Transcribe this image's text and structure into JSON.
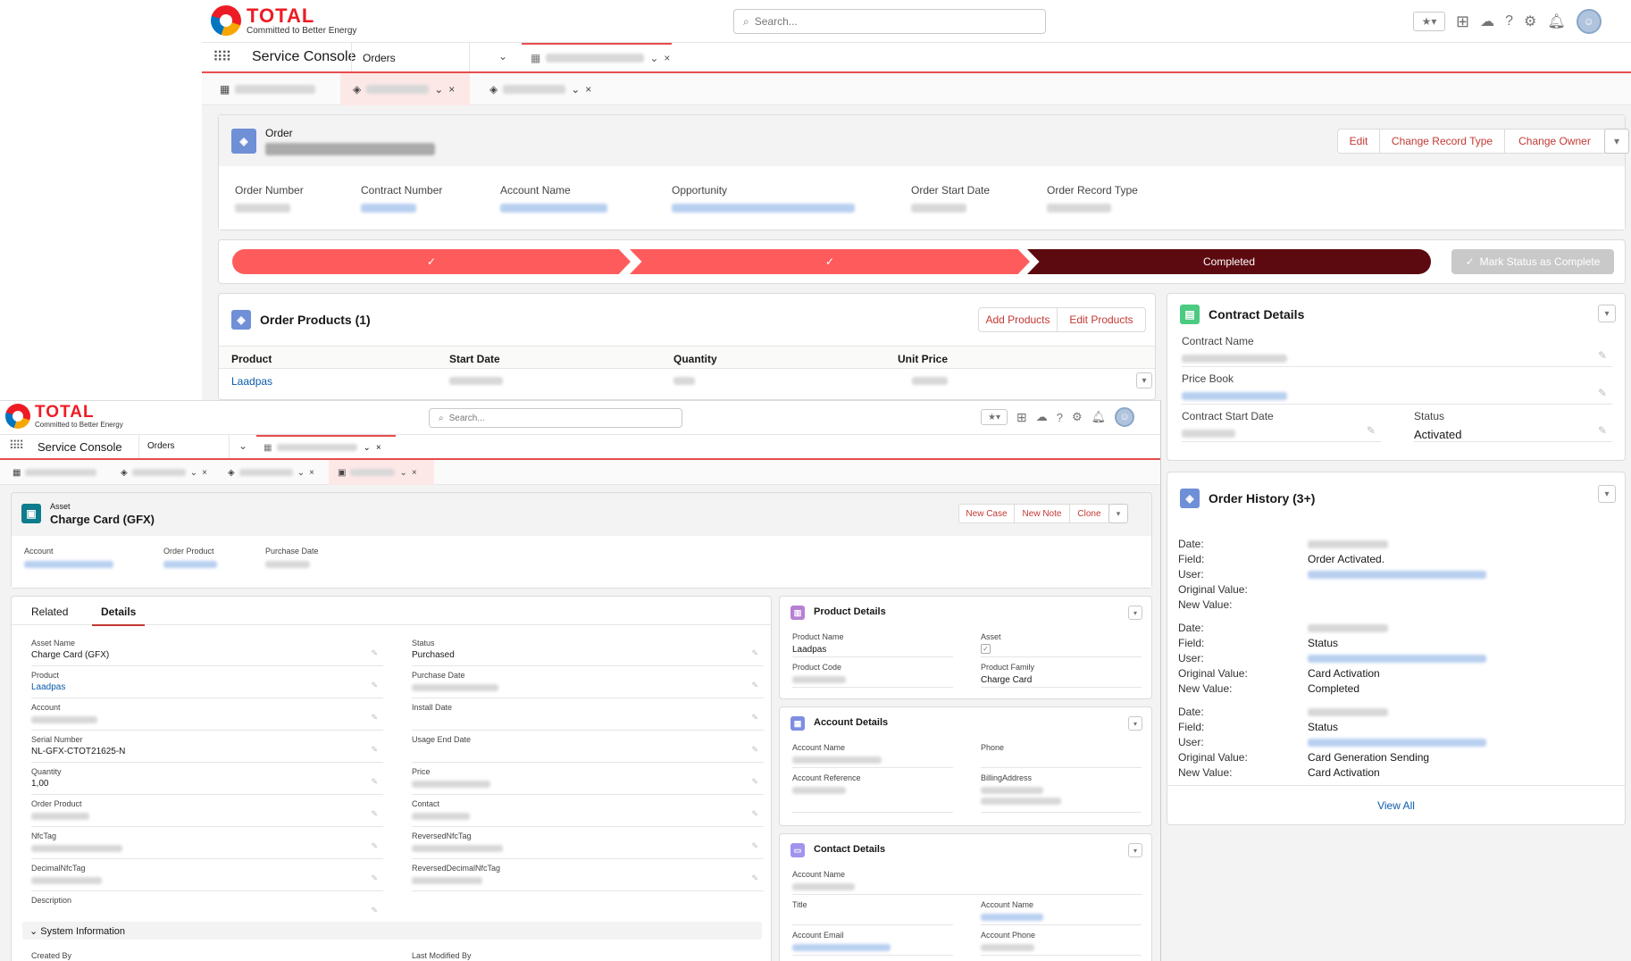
{
  "brand": {
    "name": "TOTAL",
    "tagline": "Committed to Better Energy"
  },
  "search": {
    "placeholder": "Search..."
  },
  "nav": {
    "app": "Service Console",
    "object": "Orders"
  },
  "order": {
    "object_label": "Order",
    "actions": [
      "Edit",
      "Change Record Type",
      "Change Owner"
    ],
    "fields": [
      {
        "label": "Order Number"
      },
      {
        "label": "Contract Number"
      },
      {
        "label": "Account Name"
      },
      {
        "label": "Opportunity"
      },
      {
        "label": "Order Start Date"
      },
      {
        "label": "Order Record Type"
      }
    ],
    "path": {
      "current": "Completed",
      "mark_button": "Mark Status as Complete"
    },
    "products": {
      "title": "Order Products (1)",
      "add": "Add Products",
      "edit": "Edit Products",
      "columns": [
        "Product",
        "Start Date",
        "Quantity",
        "Unit Price"
      ],
      "row": {
        "product": "Laadpas"
      }
    },
    "contract": {
      "title": "Contract Details",
      "contract_name": "Contract Name",
      "price_book": "Price Book",
      "start_date": "Contract Start Date",
      "status_label": "Status",
      "status_value": "Activated"
    },
    "history": {
      "title": "Order History (3+)",
      "view_all": "View All",
      "labels": {
        "date": "Date:",
        "field": "Field:",
        "user": "User:",
        "orig": "Original Value:",
        "new": "New Value:"
      },
      "entries": [
        {
          "field": "Order Activated.",
          "orig": "",
          "new": ""
        },
        {
          "field": "Status",
          "orig": "Card Activation",
          "new": "Completed"
        },
        {
          "field": "Status",
          "orig": "Card Generation Sending",
          "new": "Card Activation"
        }
      ]
    }
  },
  "asset": {
    "object_label": "Asset",
    "title": "Charge Card (GFX)",
    "actions": [
      "New Case",
      "New Note",
      "Clone"
    ],
    "hl_fields": [
      "Account",
      "Order Product",
      "Purchase Date"
    ],
    "tabs": [
      "Related",
      "Details"
    ],
    "details_left": [
      {
        "label": "Asset Name",
        "value": "Charge Card (GFX)"
      },
      {
        "label": "Product",
        "value": "Laadpas",
        "link": true
      },
      {
        "label": "Account",
        "value": ""
      },
      {
        "label": "Serial Number",
        "value": "NL-GFX-CTOT21625-N"
      },
      {
        "label": "Quantity",
        "value": "1,00"
      },
      {
        "label": "Order Product",
        "value": ""
      },
      {
        "label": "NfcTag",
        "value": ""
      },
      {
        "label": "DecimalNfcTag",
        "value": ""
      },
      {
        "label": "Description",
        "value": ""
      }
    ],
    "details_right": [
      {
        "label": "Status",
        "value": "Purchased"
      },
      {
        "label": "Purchase Date",
        "value": ""
      },
      {
        "label": "Install Date",
        "value": ""
      },
      {
        "label": "Usage End Date",
        "value": ""
      },
      {
        "label": "Price",
        "value": ""
      },
      {
        "label": "Contact",
        "value": ""
      },
      {
        "label": "ReversedNfcTag",
        "value": ""
      },
      {
        "label": "ReversedDecimalNfcTag",
        "value": ""
      }
    ],
    "system": {
      "title": "System Information",
      "created_by": "Created By",
      "modified_by": "Last Modified By"
    },
    "product_details": {
      "title": "Product Details",
      "product_name": "Product Name",
      "product_name_val": "Laadpas",
      "asset": "Asset",
      "product_code": "Product Code",
      "product_family": "Product Family",
      "product_family_val": "Charge Card"
    },
    "account_details": {
      "title": "Account Details",
      "account_name": "Account Name",
      "phone": "Phone",
      "account_ref": "Account Reference",
      "billing": "BillingAddress"
    },
    "contact_details": {
      "title": "Contact Details",
      "account_name": "Account Name",
      "title_lbl": "Title",
      "account_name2": "Account Name",
      "email": "Account Email",
      "phone": "Account Phone"
    }
  },
  "colors": {
    "accent": "#c23934",
    "path": "#fe5c5c",
    "path_done": "#5c0a0f",
    "link": "#0b5cab"
  }
}
